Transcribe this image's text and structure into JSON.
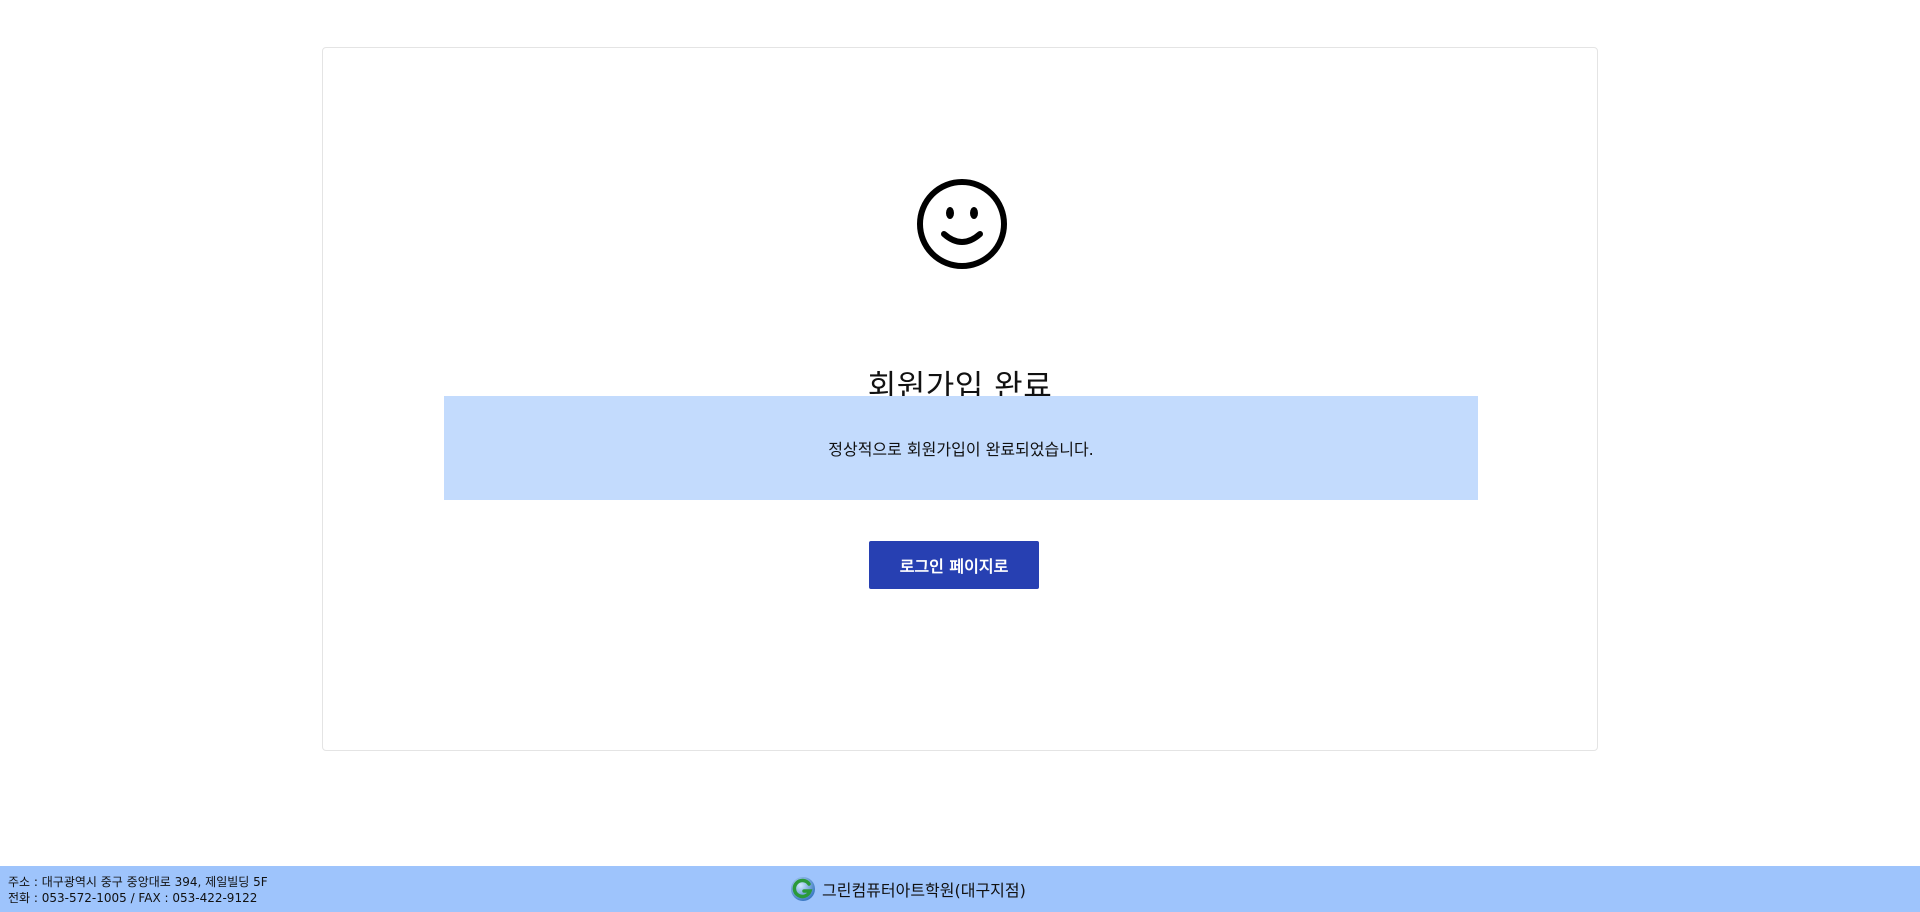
{
  "main": {
    "icon": "smiley-icon",
    "title": "회원가입 완료",
    "message": "정상적으로 회원가입이 완료되었습니다.",
    "login_button_label": "로그인 페이지로"
  },
  "footer": {
    "address": "주소 : 대구광역시 중구 중앙대로 394, 제일빌딩 5F",
    "contact": "전화 : 053-572-1005 / FAX : 053-422-9122",
    "logo_icon": "green-g-logo-icon",
    "brand_name": "그린컴퓨터아트학원(대구지점)"
  },
  "colors": {
    "message_bg": "#c3dbfd",
    "button_bg": "#2740b2",
    "footer_bg": "#9ec4fc"
  }
}
